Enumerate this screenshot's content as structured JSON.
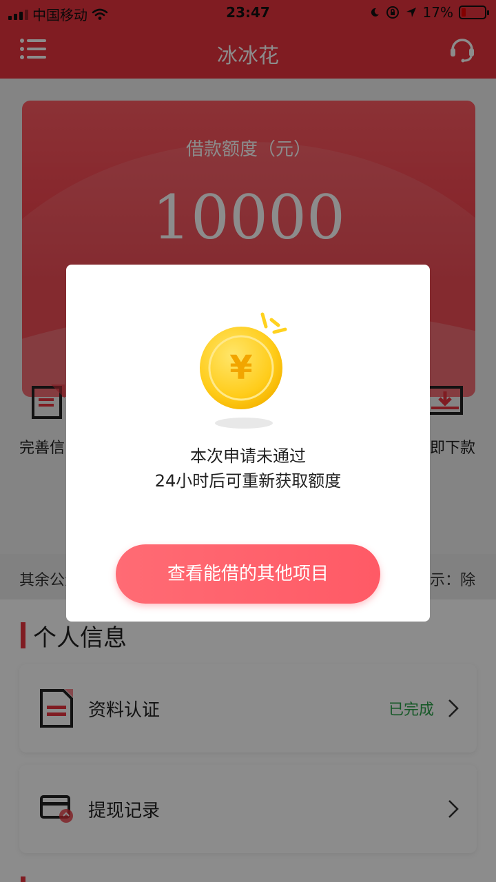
{
  "status_bar": {
    "carrier": "中国移动",
    "time": "23:47",
    "battery": "17%"
  },
  "nav": {
    "title": "冰冰花"
  },
  "hero": {
    "label": "借款额度（元）",
    "amount": "10000"
  },
  "steps": {
    "left_label": "完善信",
    "right_label": "即下款"
  },
  "notice": {
    "left_text": "其余公众",
    "right_text": "示：除"
  },
  "section": {
    "title": "个人信息",
    "items": [
      {
        "label": "资料认证",
        "status": "已完成"
      },
      {
        "label": "提现记录",
        "status": ""
      }
    ]
  },
  "modal": {
    "message_line1": "本次申请未通过",
    "message_line2": "24小时后可重新获取额度",
    "button_label": "查看能借的其他项目"
  },
  "colors": {
    "brand_red": "#e9343f",
    "success_green": "#2aa24a",
    "button_pink": "#ff6b74"
  }
}
